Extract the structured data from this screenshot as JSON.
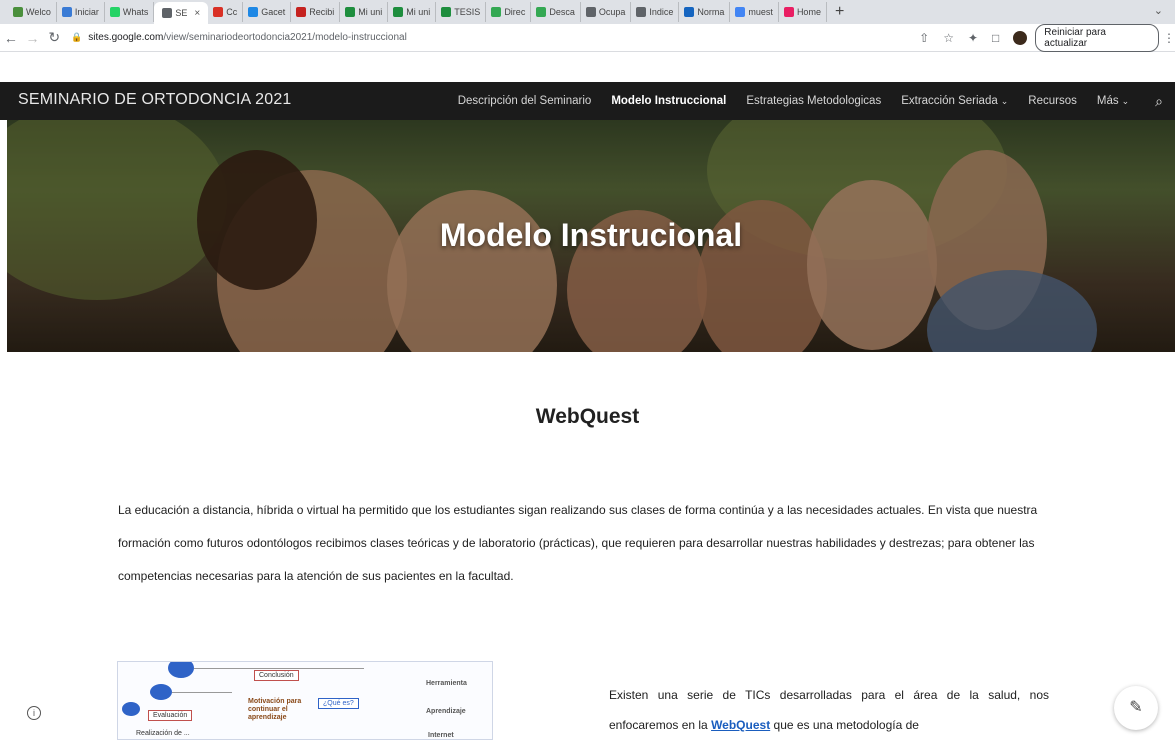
{
  "browser": {
    "tabs": [
      {
        "label": "Welco",
        "color": "#4a8f3c"
      },
      {
        "label": "Iniciar",
        "color": "#3a7bd5"
      },
      {
        "label": "Whats",
        "color": "#25d366"
      },
      {
        "label": "SE",
        "color": "#5f6368",
        "active": true
      },
      {
        "label": "Cc",
        "color": "#d93025"
      },
      {
        "label": "Gacet",
        "color": "#1e88e5"
      },
      {
        "label": "Recibi",
        "color": "#c5221f"
      },
      {
        "label": "Mi uni",
        "color": "#1e8e3e"
      },
      {
        "label": "Mi uni",
        "color": "#1e8e3e"
      },
      {
        "label": "TESIS",
        "color": "#1e8e3e"
      },
      {
        "label": "Direc",
        "color": "#34a853"
      },
      {
        "label": "Desca",
        "color": "#34a853"
      },
      {
        "label": "Ocupa",
        "color": "#5f6368"
      },
      {
        "label": "Indice",
        "color": "#5f6368"
      },
      {
        "label": "Norma",
        "color": "#1565c0"
      },
      {
        "label": "muest",
        "color": "#4285f4"
      },
      {
        "label": "Home",
        "color": "#e91e63"
      }
    ],
    "new_tab_icon": "+",
    "tab_menu_icon": "chevron-down",
    "url_host": "sites.google.com",
    "url_path": "/view/seminariodeortodoncia2021/modelo-instruccional",
    "restart_label": "Reiniciar para actualizar"
  },
  "site": {
    "title": "SEMINARIO DE ORTODONCIA 2021",
    "nav": [
      {
        "label": "Descripción del Seminario"
      },
      {
        "label": "Modelo Instruccional",
        "active": true
      },
      {
        "label": "Estrategias Metodologicas"
      },
      {
        "label": "Extracción Seriada",
        "dropdown": true
      },
      {
        "label": "Recursos"
      },
      {
        "label": "Más",
        "dropdown": true
      }
    ]
  },
  "hero": {
    "title": "Modelo Instrucional"
  },
  "content": {
    "section_title": "WebQuest",
    "paragraph": "La educación a distancia, híbrida o virtual ha permitido que los estudiantes sigan realizando sus clases de forma continúa y a las necesidades actuales. En vista que nuestra formación como futuros odontólogos recibimos clases teóricas y de laboratorio (prácticas), que requieren para desarrollar nuestras habilidades y destrezas; para obtener las competencias necesarias para la atención de sus pacientes en la facultad.",
    "side_text_before": "Existen una serie de TICs desarrolladas para el área de la salud, nos enfocaremos en la ",
    "side_link": "WebQuest",
    "side_text_after": " que es una metodología de",
    "diagram": {
      "labels": [
        "Conclusión",
        "Herramienta",
        "Motivación para continuar el aprendizaje",
        "¿Qué es?",
        "Aprendizaje",
        "Evaluación",
        "Realización de ...",
        "Internet"
      ]
    }
  },
  "colors": {
    "nav_bg": "#1b1b1b",
    "link": "#1a5dbe",
    "accent_blue": "#2f63c7"
  }
}
